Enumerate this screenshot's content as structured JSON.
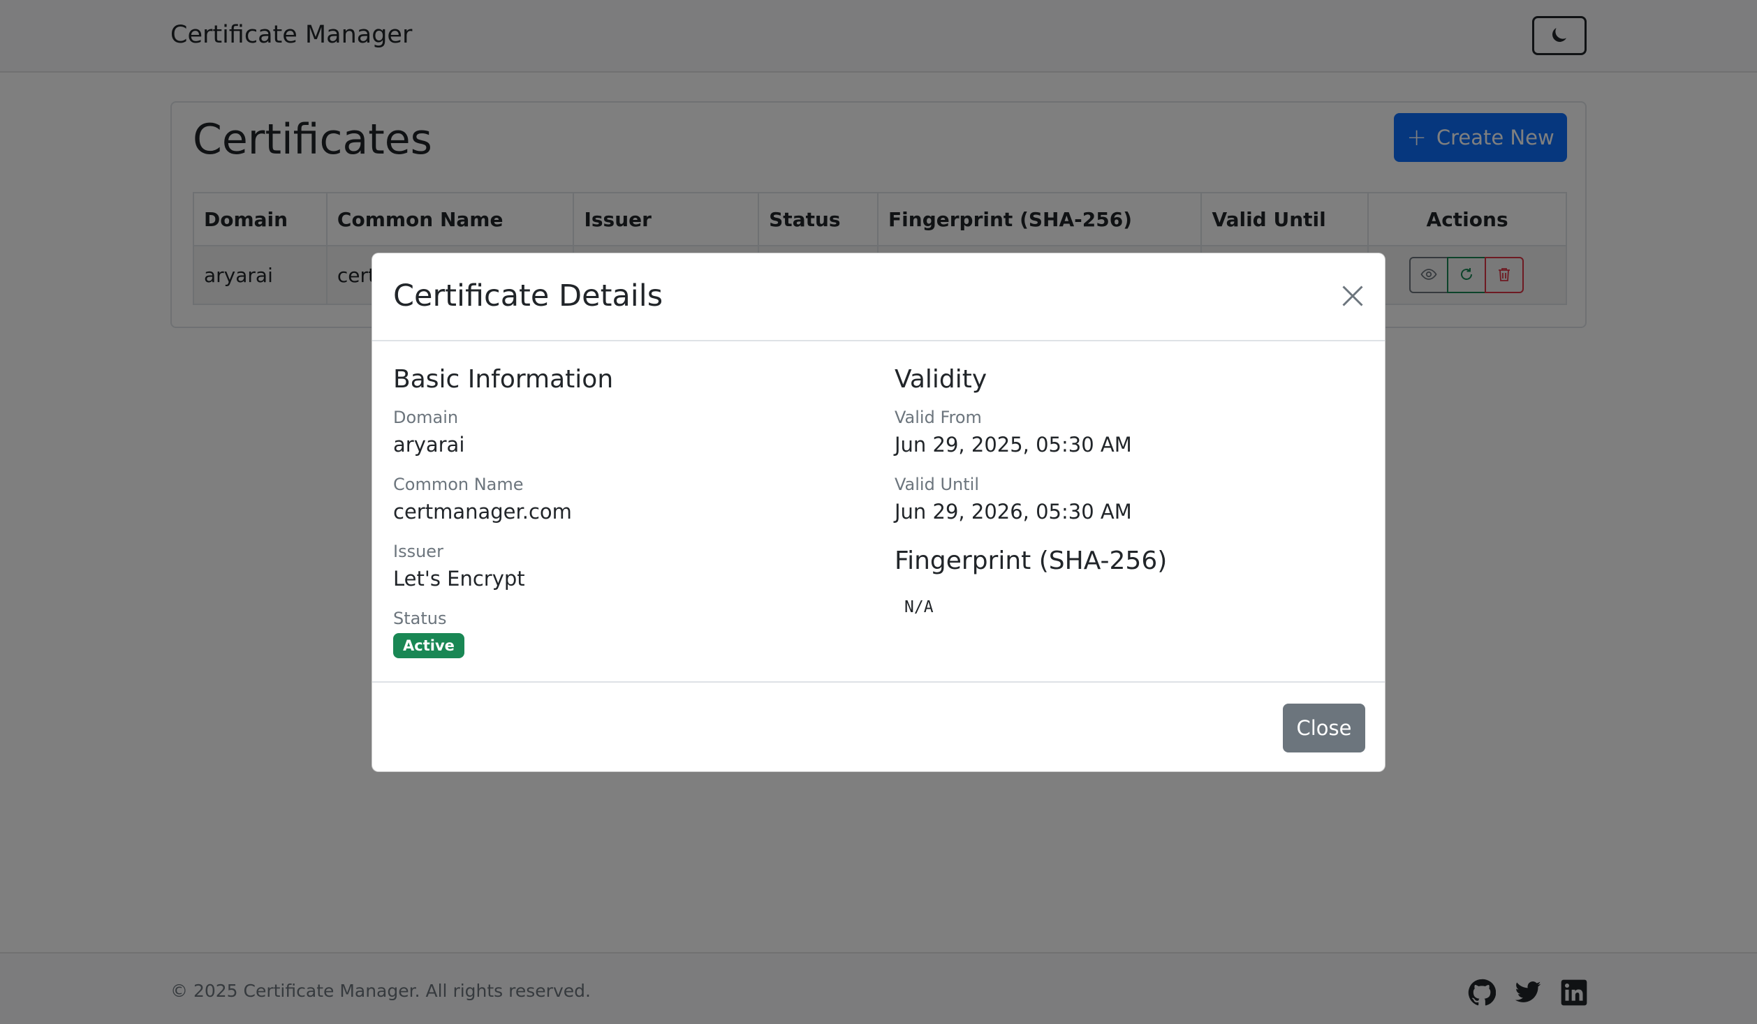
{
  "navbar": {
    "brand": "Certificate Manager",
    "theme_toggle_icon": "moon-icon"
  },
  "page": {
    "title": "Certificates",
    "create_button_label": "Create New",
    "create_button_icon": "plus-icon"
  },
  "table": {
    "headers": [
      "Domain",
      "Common Name",
      "Issuer",
      "Status",
      "Fingerprint (SHA-256)",
      "Valid Until",
      "Actions"
    ],
    "rows": [
      {
        "domain": "aryarai",
        "common_name": "cert"
      }
    ],
    "action_icons": [
      "eye-icon",
      "refresh-icon",
      "trash-icon"
    ]
  },
  "modal": {
    "title": "Certificate Details",
    "basic": {
      "heading": "Basic Information",
      "domain_label": "Domain",
      "domain": "aryarai",
      "common_name_label": "Common Name",
      "common_name": "certmanager.com",
      "issuer_label": "Issuer",
      "issuer": "Let's Encrypt",
      "status_label": "Status",
      "status": "Active"
    },
    "validity": {
      "heading": "Validity",
      "valid_from_label": "Valid From",
      "valid_from": "Jun 29, 2025, 05:30 AM",
      "valid_until_label": "Valid Until",
      "valid_until": "Jun 29, 2026, 05:30 AM"
    },
    "fingerprint": {
      "heading": "Fingerprint (SHA-256)",
      "value": "N/A"
    },
    "close_label": "Close"
  },
  "footer": {
    "copyright": "© 2025 Certificate Manager. All rights reserved.",
    "social_icons": [
      "github-icon",
      "twitter-icon",
      "linkedin-icon"
    ]
  },
  "colors": {
    "primary": "#0d6efd",
    "success": "#198754",
    "danger": "#dc3545",
    "secondary": "#6c757d"
  }
}
